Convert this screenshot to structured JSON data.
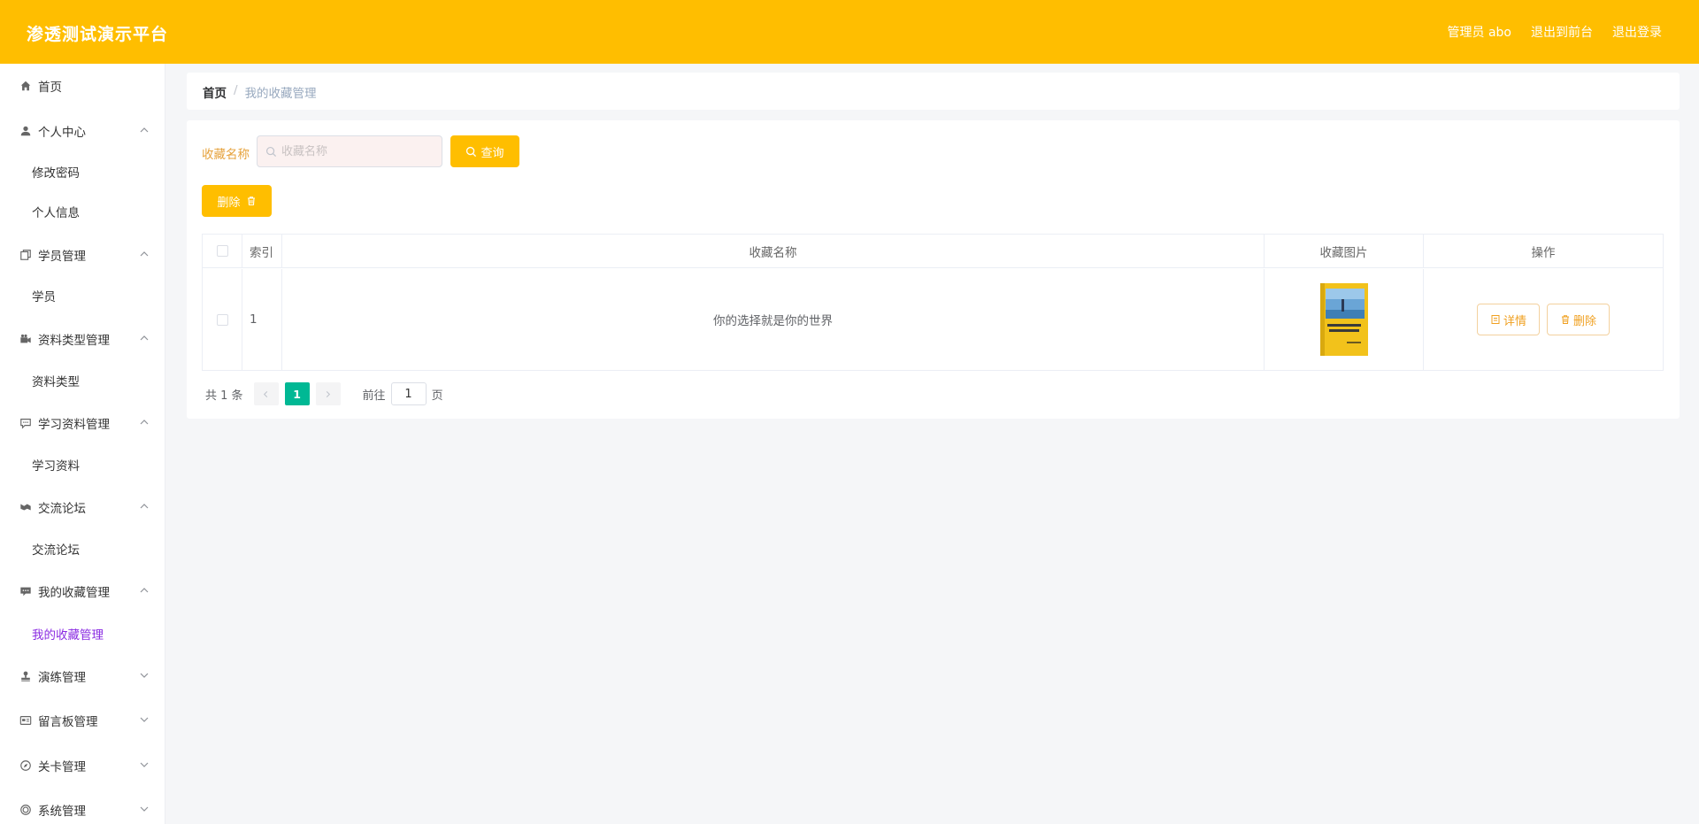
{
  "header": {
    "title": "渗透测试演示平台",
    "user_label": "管理员 abo",
    "exit_front": "退出到前台",
    "logout": "退出登录"
  },
  "sidebar": {
    "items": [
      {
        "label": "首页",
        "icon": "home-icon",
        "arrow": "none"
      },
      {
        "label": "个人中心",
        "icon": "user-icon",
        "arrow": "up",
        "children": [
          "修改密码",
          "个人信息"
        ]
      },
      {
        "label": "学员管理",
        "icon": "copy-icon",
        "arrow": "up",
        "children": [
          "学员"
        ]
      },
      {
        "label": "资料类型管理",
        "icon": "camera-icon",
        "arrow": "up",
        "children": [
          "资料类型"
        ]
      },
      {
        "label": "学习资料管理",
        "icon": "message-icon",
        "arrow": "up",
        "children": [
          "学习资料"
        ]
      },
      {
        "label": "交流论坛",
        "icon": "video-icon",
        "arrow": "up",
        "children": [
          "交流论坛"
        ]
      },
      {
        "label": "我的收藏管理",
        "icon": "chat-icon",
        "arrow": "up",
        "children": [
          "我的收藏管理"
        ]
      },
      {
        "label": "演练管理",
        "icon": "stamp-icon",
        "arrow": "down"
      },
      {
        "label": "留言板管理",
        "icon": "postcard-icon",
        "arrow": "down"
      },
      {
        "label": "关卡管理",
        "icon": "compass-icon",
        "arrow": "down"
      },
      {
        "label": "系统管理",
        "icon": "target-icon",
        "arrow": "down"
      }
    ],
    "active_sub": "我的收藏管理"
  },
  "breadcrumb": {
    "home": "首页",
    "separator": "/",
    "current": "我的收藏管理"
  },
  "search": {
    "label": "收藏名称",
    "placeholder": "收藏名称",
    "value": "",
    "button_label": "查询"
  },
  "toolbar": {
    "delete_label": "删除"
  },
  "table": {
    "columns": [
      "",
      "索引",
      "收藏名称",
      "收藏图片",
      "操作"
    ],
    "rows": [
      {
        "index": "1",
        "name": "你的选择就是你的世界",
        "image": "book-cover",
        "actions": [
          "详情",
          "删除"
        ]
      }
    ]
  },
  "pagination": {
    "total_text": "共 1 条",
    "current_page": "1",
    "goto_label": "前往",
    "goto_value": "1",
    "goto_unit": "页"
  },
  "colors": {
    "primary": "#ffbe00",
    "active_sub": "#8a2be2",
    "page_active": "#00b894",
    "search_label": "#e6a23c"
  }
}
